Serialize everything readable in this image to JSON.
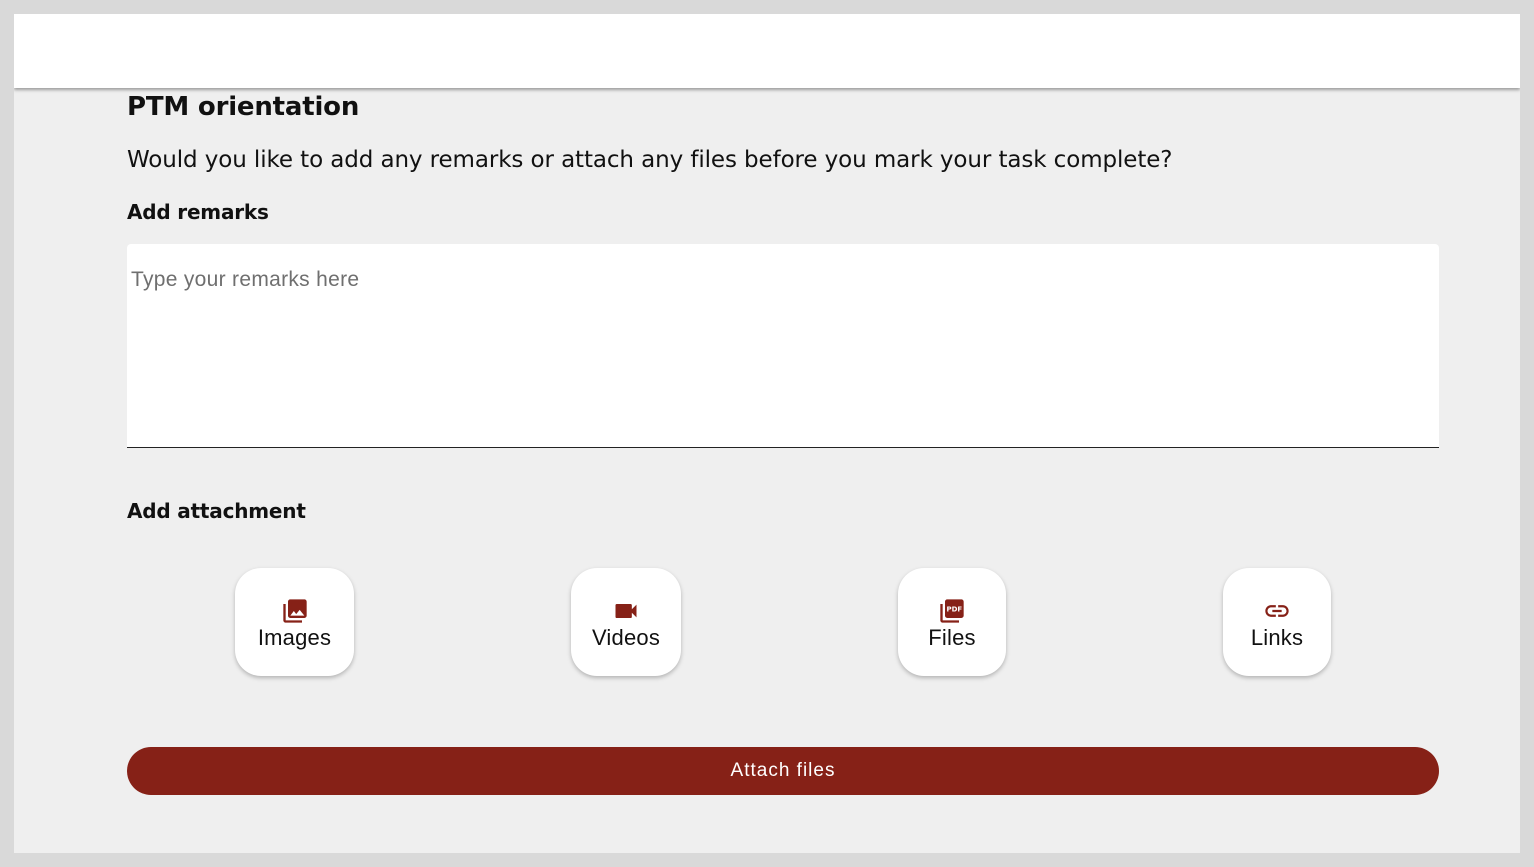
{
  "header": {},
  "page": {
    "title": "PTM orientation",
    "question": "Would you like to add any remarks or attach any files before you mark your task complete?"
  },
  "remarks": {
    "label": "Add remarks",
    "placeholder": "Type your remarks here",
    "value": ""
  },
  "attachment": {
    "label": "Add attachment",
    "options": [
      {
        "label": "Images",
        "icon": "image-icon"
      },
      {
        "label": "Videos",
        "icon": "video-camera-icon"
      },
      {
        "label": "Files",
        "icon": "pdf-file-icon"
      },
      {
        "label": "Links",
        "icon": "link-icon"
      }
    ]
  },
  "actions": {
    "attach_label": "Attach files"
  },
  "colors": {
    "accent": "#862117",
    "background": "#efefef",
    "header": "#ffffff"
  }
}
